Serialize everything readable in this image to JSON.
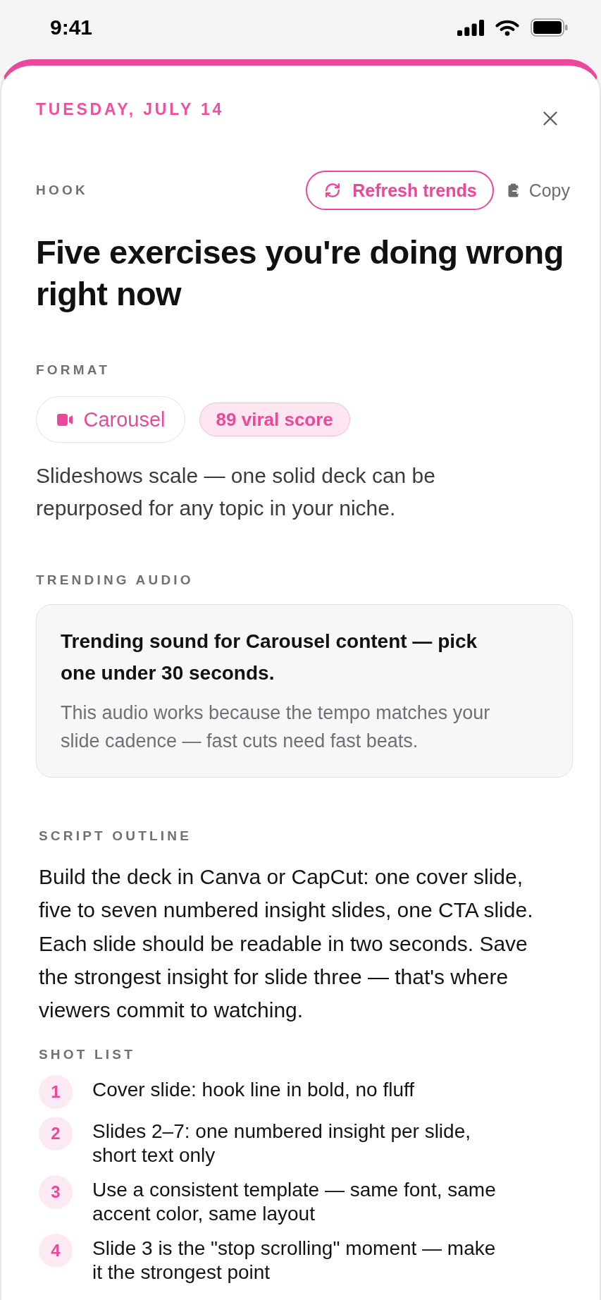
{
  "status_bar": {
    "time": "9:41"
  },
  "header": {
    "date": "TUESDAY, JULY 14"
  },
  "hook": {
    "label": "HOOK",
    "refresh_button": "Refresh trends",
    "copy_button": "Copy",
    "title": "Five exercises you're doing wrong right now"
  },
  "format": {
    "label": "FORMAT",
    "format_chip": "Carousel",
    "score_badge": "89 viral score",
    "description": "Slideshows scale — one solid deck can be repurposed for any topic in your niche."
  },
  "trending_audio": {
    "label": "TRENDING AUDIO",
    "title": "Trending sound for Carousel content — pick one under 30 seconds.",
    "explanation": "This audio works because the tempo matches your slide cadence — fast cuts need fast beats."
  },
  "script_outline": {
    "label": "SCRIPT OUTLINE",
    "text": "Build the deck in Canva or CapCut: one cover slide, five to seven numbered insight slides, one CTA slide. Each slide should be readable in two seconds. Save the strongest insight for slide three — that's where viewers commit to watching."
  },
  "shot_list": {
    "label": "SHOT LIST",
    "items": [
      {
        "number": "1",
        "text": "Cover slide: hook line in bold, no fluff"
      },
      {
        "number": "2",
        "text": "Slides 2–7: one numbered insight per slide, short text only"
      },
      {
        "number": "3",
        "text": "Use a consistent template — same font, same accent color, same layout"
      },
      {
        "number": "4",
        "text": "Slide 3 is the \"stop scrolling\" moment — make it the strongest point"
      }
    ]
  }
}
